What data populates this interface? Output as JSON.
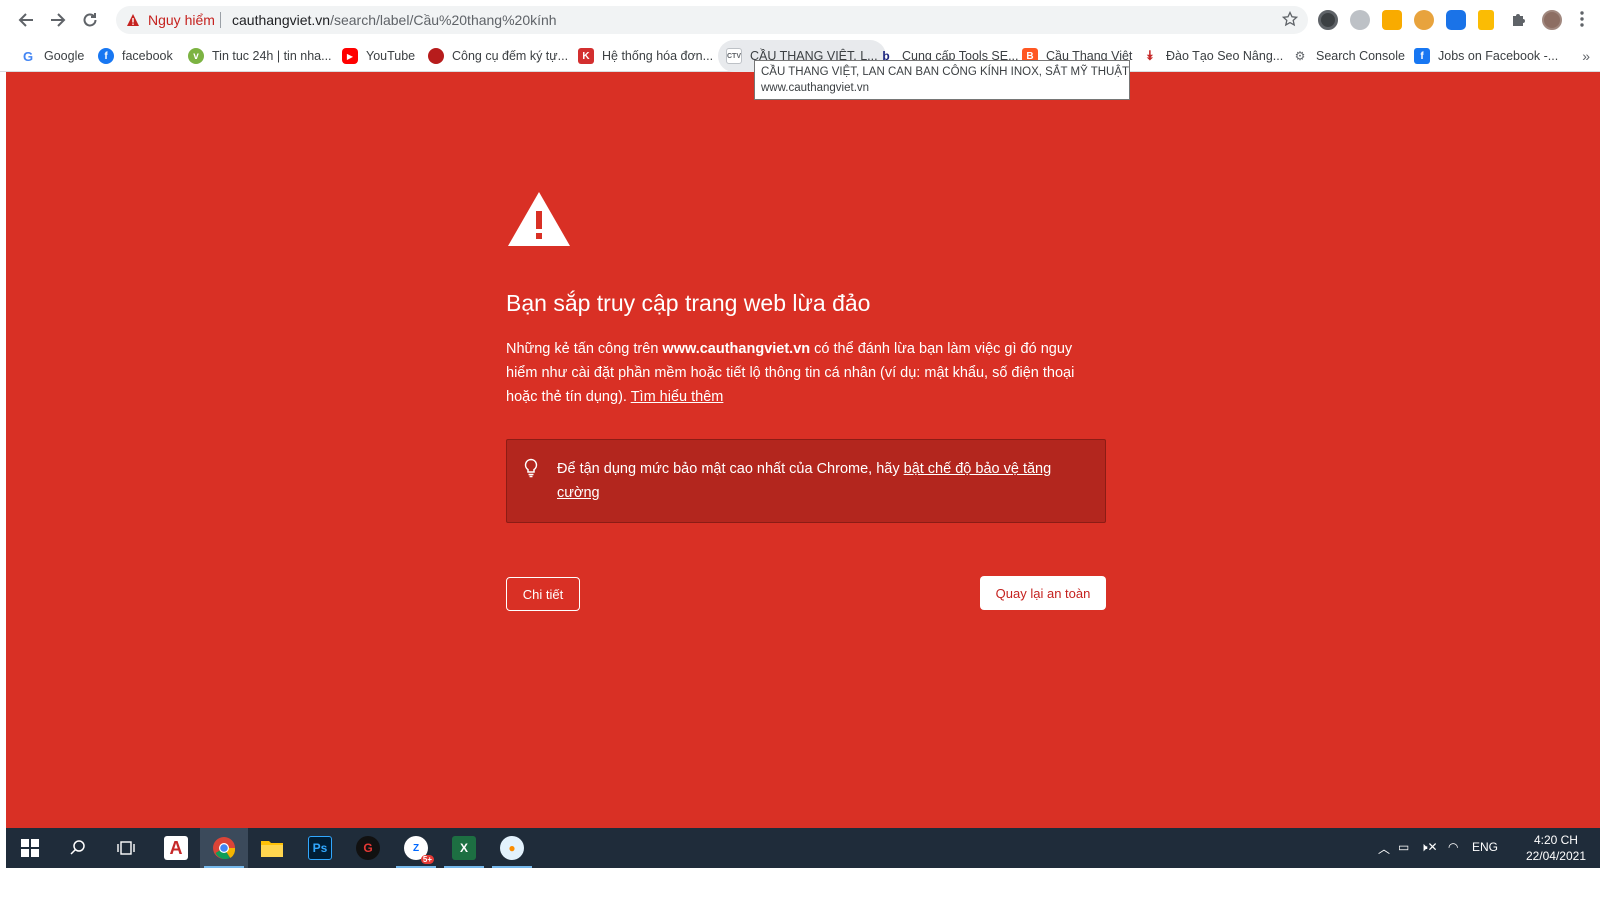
{
  "toolbar": {
    "danger_label": "Nguy hiểm",
    "url_domain": "cauthangviet.vn",
    "url_path": "/search/label/Cầu%20thang%20kính"
  },
  "bookmarks": [
    {
      "label": "Google",
      "icon": "google-icon"
    },
    {
      "label": "facebook",
      "icon": "facebook-icon"
    },
    {
      "label": "Tin tuc 24h | tin nha...",
      "icon": "news-icon"
    },
    {
      "label": "YouTube",
      "icon": "youtube-icon"
    },
    {
      "label": "Công cụ đếm ký tự...",
      "icon": "tool-icon"
    },
    {
      "label": "Hệ thống hóa đơn...",
      "icon": "invoice-icon"
    },
    {
      "label": "CẦU THANG VIỆT, L...",
      "icon": "site-icon"
    },
    {
      "label": "Cung cấp Tools SE...",
      "icon": "tools-icon"
    },
    {
      "label": "Cầu Thang Việt",
      "icon": "blogger-icon"
    },
    {
      "label": "Đào Tạo Seo Nâng...",
      "icon": "seo-icon"
    },
    {
      "label": "Search Console",
      "icon": "search-console-icon"
    },
    {
      "label": "Jobs on Facebook -...",
      "icon": "facebook-jobs-icon"
    }
  ],
  "tooltip": {
    "title": "CẦU THANG VIỆT, LAN CAN BAN CÔNG KÍNH INOX, SẮT MỸ THUẬT",
    "url": "www.cauthangviet.vn"
  },
  "interstitial": {
    "heading": "Bạn sắp truy cập trang web lừa đảo",
    "body_prefix": "Những kẻ tấn công trên ",
    "body_domain": "www.cauthangviet.vn",
    "body_suffix": " có thể đánh lừa bạn làm việc gì đó nguy hiểm như cài đặt phần mềm hoặc tiết lộ thông tin cá nhân (ví dụ: mật khẩu, số điện thoại hoặc thẻ tín dụng). ",
    "learn_more": "Tìm hiểu thêm",
    "tip_prefix": "Để tận dụng mức bảo mật cao nhất của Chrome, hãy ",
    "tip_link": "bật chế độ bảo vệ tăng cường",
    "details_button": "Chi tiết",
    "back_button": "Quay lại an toàn",
    "background_color": "#d93025"
  },
  "taskbar": {
    "language": "ENG",
    "time": "4:20 CH",
    "date": "22/04/2021",
    "zalo_badge": "5+"
  }
}
